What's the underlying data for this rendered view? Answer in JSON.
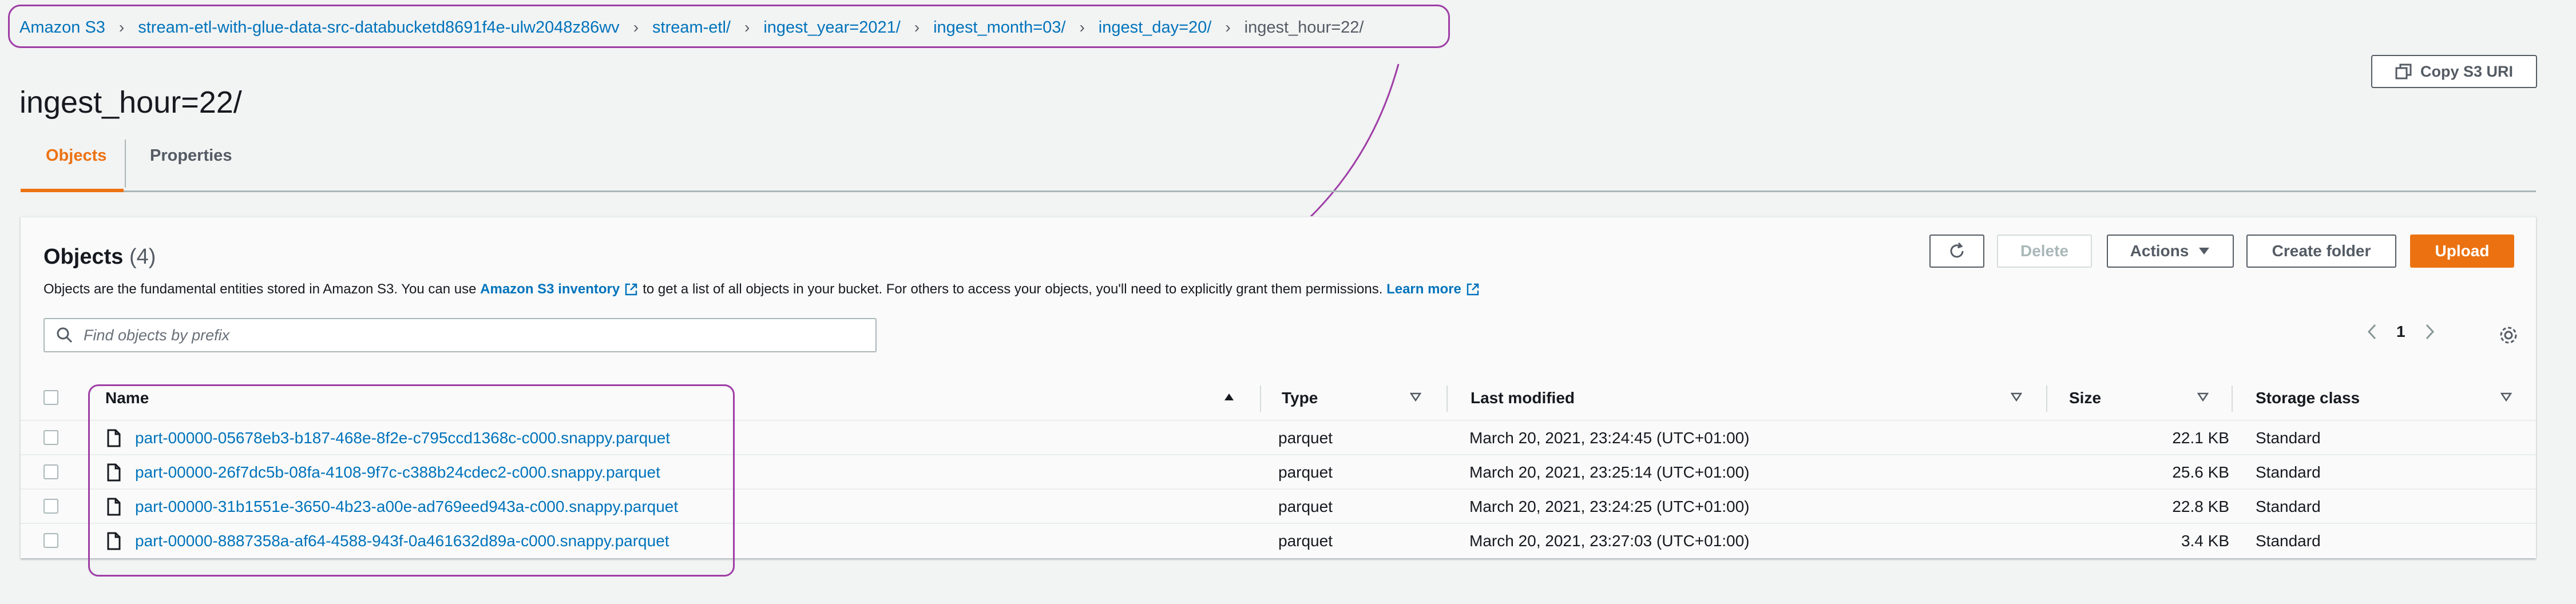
{
  "breadcrumb": [
    {
      "label": "Amazon S3"
    },
    {
      "label": "stream-etl-with-glue-data-src-databucketd8691f4e-ulw2048z86wv"
    },
    {
      "label": "stream-etl/"
    },
    {
      "label": "ingest_year=2021/"
    },
    {
      "label": "ingest_month=03/"
    },
    {
      "label": "ingest_day=20/"
    },
    {
      "label": "ingest_hour=22/"
    }
  ],
  "page_title": "ingest_hour=22/",
  "copy_uri_label": "Copy S3 URI",
  "tabs": [
    {
      "label": "Objects"
    },
    {
      "label": "Properties"
    }
  ],
  "objects": {
    "title": "Objects",
    "count": "(4)",
    "desc_prefix": "Objects are the fundamental entities stored in Amazon S3. You can use",
    "inventory_link": "Amazon S3 inventory",
    "desc_middle": "to get a list of all objects in your bucket. For others to access your objects, you'll need to explicitly grant them permissions.",
    "learn_more": "Learn more",
    "buttons": {
      "delete": "Delete",
      "actions": "Actions",
      "create_folder": "Create folder",
      "upload": "Upload"
    },
    "search_placeholder": "Find objects by prefix",
    "page": "1",
    "columns": {
      "name": "Name",
      "type": "Type",
      "last_modified": "Last modified",
      "size": "Size",
      "storage_class": "Storage class"
    },
    "rows": [
      {
        "name": "part-00000-05678eb3-b187-468e-8f2e-c795ccd1368c-c000.snappy.parquet",
        "type": "parquet",
        "modified": "March 20, 2021, 23:24:45 (UTC+01:00)",
        "size": "22.1 KB",
        "storage": "Standard"
      },
      {
        "name": "part-00000-26f7dc5b-08fa-4108-9f7c-c388b24cdec2-c000.snappy.parquet",
        "type": "parquet",
        "modified": "March 20, 2021, 23:25:14 (UTC+01:00)",
        "size": "25.6 KB",
        "storage": "Standard"
      },
      {
        "name": "part-00000-31b1551e-3650-4b23-a00e-ad769eed943a-c000.snappy.parquet",
        "type": "parquet",
        "modified": "March 20, 2021, 23:24:25 (UTC+01:00)",
        "size": "22.8 KB",
        "storage": "Standard"
      },
      {
        "name": "part-00000-8887358a-af64-4588-943f-0a461632d89a-c000.snappy.parquet",
        "type": "parquet",
        "modified": "March 20, 2021, 23:27:03 (UTC+01:00)",
        "size": "3.4 KB",
        "storage": "Standard"
      }
    ]
  },
  "icons": {
    "refresh": "refresh-icon",
    "caret": "caret-down-icon",
    "search": "search-icon",
    "external": "external-link-icon",
    "file": "file-icon",
    "settings": "gear-icon"
  },
  "colors": {
    "accent": "#ec7211",
    "link": "#0073bb",
    "annotation": "#9e3ea6"
  }
}
